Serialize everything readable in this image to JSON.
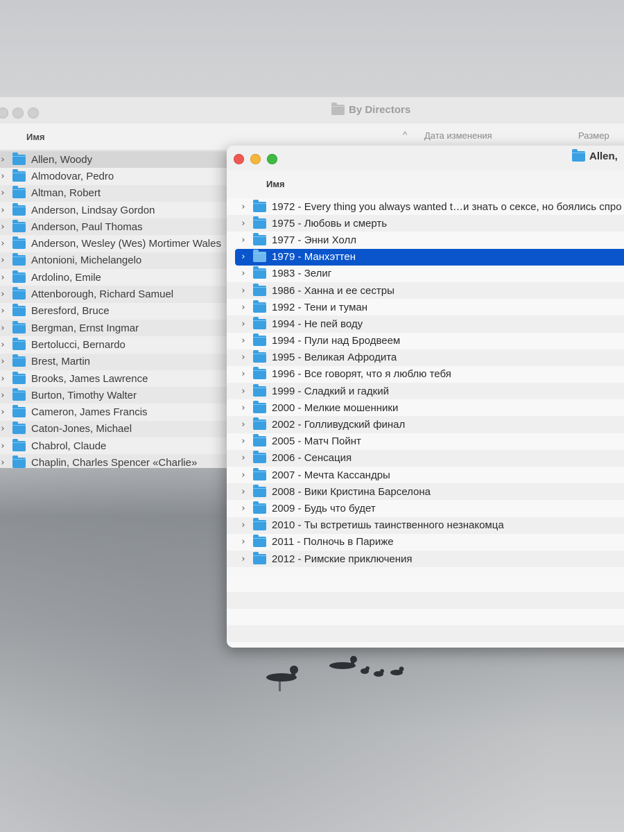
{
  "back_window": {
    "title": "By Directors",
    "column_headers": {
      "name": "Имя",
      "sort_indicator": "^",
      "date_modified": "Дата изменения",
      "size": "Размер"
    },
    "items": [
      "Allen, Woody",
      "Almodovar, Pedro",
      "Altman, Robert",
      "Anderson, Lindsay Gordon",
      "Anderson, Paul Thomas",
      "Anderson, Wesley (Wes) Mortimer Wales",
      "Antonioni, Michelangelo",
      "Ardolino, Emile",
      "Attenborough, Richard Samuel",
      "Beresford, Bruce",
      "Bergman, Ernst Ingmar",
      "Bertolucci, Bernardo",
      "Brest, Martin",
      "Brooks, James Lawrence",
      "Burton, Timothy Walter",
      "Cameron, James Francis",
      "Caton-Jones, Michael",
      "Chabrol, Claude",
      "Chaplin, Charles Spencer «Charlie»"
    ],
    "selected_item": "Allen, Woody"
  },
  "front_window": {
    "title": "Allen,",
    "column_headers": {
      "name": "Имя"
    },
    "items": [
      "1972 - Every thing you always wanted t…и знать о сексе, но боялись спро",
      "1975 - Любовь и смерть",
      "1977 - Энни Холл",
      "1979 - Манхэттен",
      "1983 - Зелиг",
      "1986 - Ханна и ее сестры",
      "1992 - Тени и туман",
      "1994 - Не пей воду",
      "1994 - Пули над Бродвеем",
      "1995 - Великая Афродита",
      "1996 - Все говорят, что я люблю тебя",
      "1999 - Сладкий и гадкий",
      "2000 - Мелкие мошенники",
      "2002 - Голливудский финал",
      "2005 - Матч Пойнт",
      "2006 - Сенсация",
      "2007 - Мечта Кассандры",
      "2008 - Вики Кристина Барселона",
      "2009 - Будь что будет",
      "2010 - Ты встретишь таинственного незнакомца",
      "2011 - Полночь в Париже",
      "2012 - Римские приключения"
    ],
    "selected_item": "1979 - Манхэттен"
  },
  "icons": {
    "folder": "folder-icon",
    "disclosure": "chevron-right-icon"
  },
  "colors": {
    "selection": "#0a55cc",
    "folder": "#3aa0e2",
    "close": "#ee5a52",
    "minimize": "#f5b73b",
    "zoom": "#3ebb43"
  }
}
